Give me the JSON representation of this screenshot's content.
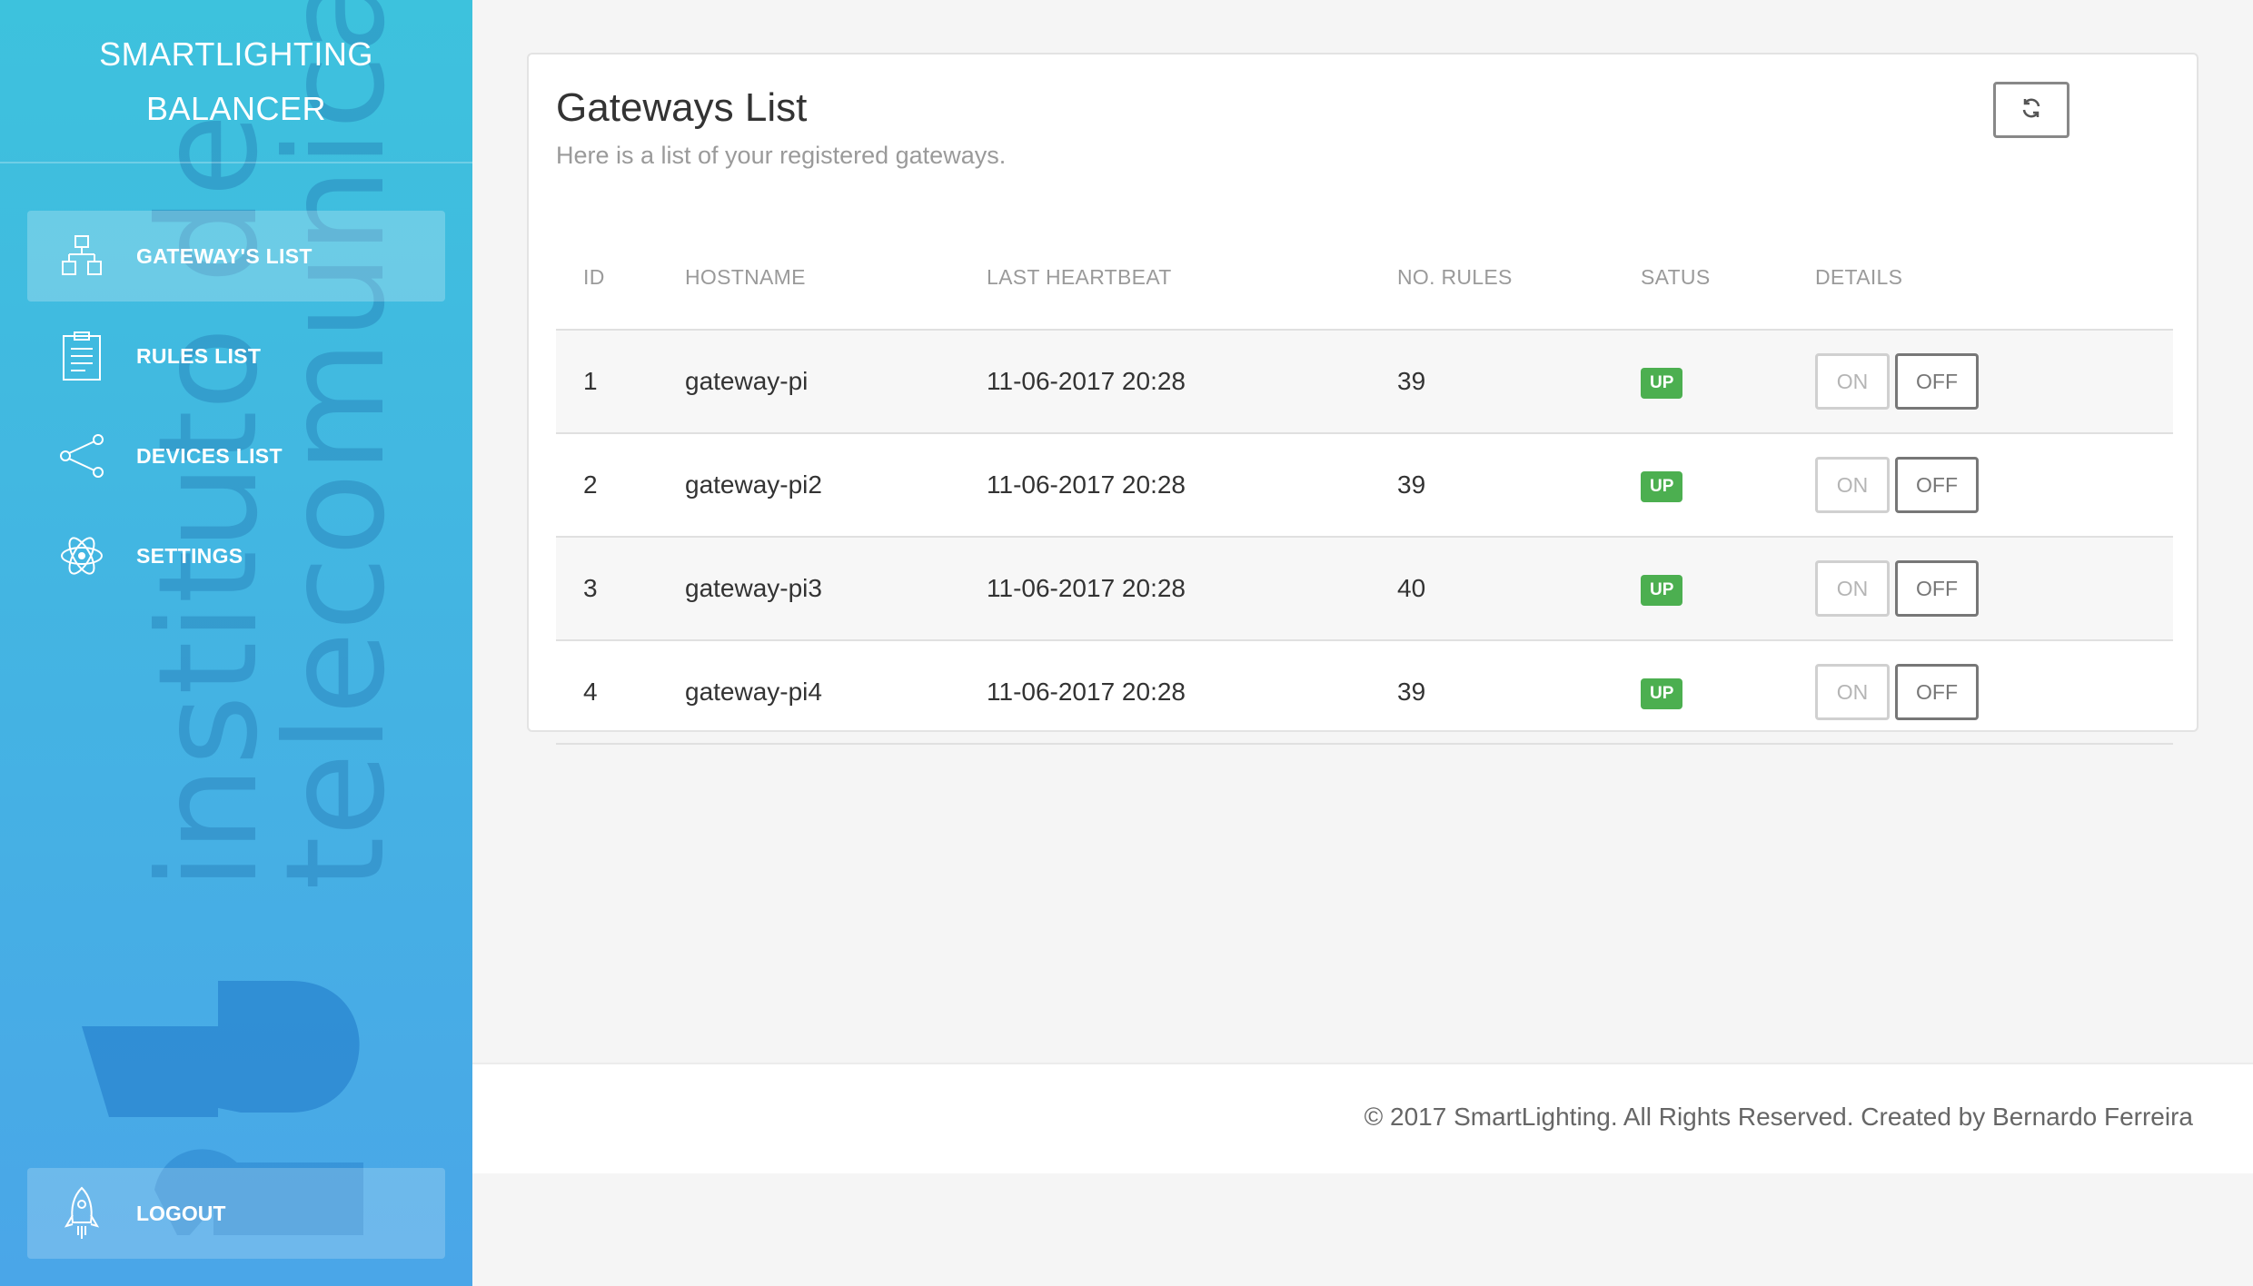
{
  "sidebar": {
    "brand_line1": "SMARTLIGHTING",
    "brand_line2": "BALANCER",
    "watermark_line1": "instituto de",
    "watermark_line2": "telecomunicações",
    "items": [
      {
        "label": "GATEWAY'S LIST",
        "icon": "sitemap-icon",
        "active": true
      },
      {
        "label": "RULES LIST",
        "icon": "clipboard-icon",
        "active": false
      },
      {
        "label": "DEVICES LIST",
        "icon": "share-icon",
        "active": false
      },
      {
        "label": "SETTINGS",
        "icon": "atom-icon",
        "active": false
      }
    ],
    "logout_label": "LOGOUT",
    "logout_icon": "rocket-icon"
  },
  "main": {
    "title": "Gateways List",
    "subtitle": "Here is a list of your registered gateways.",
    "refresh_icon": "refresh-icon",
    "columns": [
      "ID",
      "HOSTNAME",
      "LAST HEARTBEAT",
      "NO. RULES",
      "SATUS",
      "DETAILS"
    ],
    "rows": [
      {
        "id": "1",
        "hostname": "gateway-pi",
        "heartbeat": "11-06-2017 20:28",
        "rules": "39",
        "status": "UP",
        "on": "ON",
        "off": "OFF"
      },
      {
        "id": "2",
        "hostname": "gateway-pi2",
        "heartbeat": "11-06-2017 20:28",
        "rules": "39",
        "status": "UP",
        "on": "ON",
        "off": "OFF"
      },
      {
        "id": "3",
        "hostname": "gateway-pi3",
        "heartbeat": "11-06-2017 20:28",
        "rules": "40",
        "status": "UP",
        "on": "ON",
        "off": "OFF"
      },
      {
        "id": "4",
        "hostname": "gateway-pi4",
        "heartbeat": "11-06-2017 20:28",
        "rules": "39",
        "status": "UP",
        "on": "ON",
        "off": "OFF"
      }
    ]
  },
  "footer": {
    "text": "© 2017 SmartLighting. All Rights Reserved. Created by Bernardo Ferreira"
  },
  "colors": {
    "sidebar_top": "#3dc2dd",
    "sidebar_bottom": "#4aa6e8",
    "status_up": "#4caf50"
  }
}
